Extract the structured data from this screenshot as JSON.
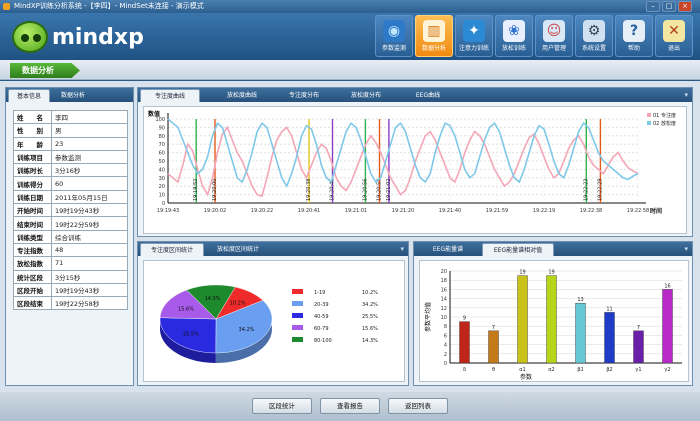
{
  "window": {
    "title": "MindXP训练分析系统 -【李四】- MindSet未连接 - 演示模式",
    "minimize": "–",
    "maximize": "□",
    "close": "×"
  },
  "logo": {
    "text": "mindxp"
  },
  "nav": [
    {
      "label": "参数监测",
      "icon": "◉"
    },
    {
      "label": "数据分析",
      "icon": "▥"
    },
    {
      "label": "注意力训练",
      "icon": "✦"
    },
    {
      "label": "放松训练",
      "icon": "❀"
    },
    {
      "label": "用户管理",
      "icon": "☺"
    },
    {
      "label": "系统设置",
      "icon": "⚙"
    },
    {
      "label": "帮助",
      "icon": "?"
    },
    {
      "label": "退出",
      "icon": "✕"
    }
  ],
  "section": {
    "title": "数据分析"
  },
  "left_tabs": [
    "基本信息",
    "数据分析"
  ],
  "info": [
    {
      "k": "姓　　名",
      "v": "李四"
    },
    {
      "k": "性　　别",
      "v": "男"
    },
    {
      "k": "年　　龄",
      "v": "23"
    },
    {
      "k": "训练项目",
      "v": "参数监测"
    },
    {
      "k": "训练时长",
      "v": "3分16秒"
    },
    {
      "k": "训练得分",
      "v": "60"
    },
    {
      "k": "训练日期",
      "v": "2011年05月15日"
    },
    {
      "k": "开始时间",
      "v": "19时19分43秒"
    },
    {
      "k": "结束时间",
      "v": "19时22分59秒"
    },
    {
      "k": "训练类型",
      "v": "综合训练"
    },
    {
      "k": "专注指数",
      "v": "48"
    },
    {
      "k": "放松指数",
      "v": "71"
    },
    {
      "k": "统计区段",
      "v": "3分15秒"
    },
    {
      "k": "区段开始",
      "v": "19时19分43秒"
    },
    {
      "k": "区段结束",
      "v": "19时22分58秒"
    }
  ],
  "chart_tabs": [
    "专注度曲线",
    "放松度曲线",
    "专注度分布",
    "放松度分布",
    "EEG曲线"
  ],
  "pie_tabs": [
    "专注度区间统计",
    "放松度区间统计"
  ],
  "bar_tabs": [
    "EEG能量谱",
    "EEG能量谱相对值"
  ],
  "footer": {
    "btn1": "区段统计",
    "btn2": "查看报告",
    "btn3": "返回列表"
  },
  "colors": {
    "attention": "#f4a6b6",
    "relaxation": "#7ec8e8",
    "accent": "#f39a14"
  },
  "chart_data": [
    {
      "type": "line",
      "ylabel": "数值",
      "xlabel": "时间",
      "ylim": [
        0,
        100
      ],
      "yticks": [
        0,
        10,
        20,
        30,
        40,
        50,
        60,
        70,
        80,
        90,
        100
      ],
      "xticks": [
        "19:19:43",
        "19:20:02",
        "19:20:22",
        "19:20:41",
        "19:21:01",
        "19:21:20",
        "19:21:40",
        "19:21:59",
        "19:22:19",
        "19:22:38",
        "19:22:58"
      ],
      "series": [
        {
          "name": "01 专注度",
          "values": [
            35,
            30,
            25,
            45,
            70,
            62,
            40,
            20,
            10,
            30,
            60,
            82,
            90,
            75,
            60,
            50,
            35,
            20,
            10,
            8,
            30,
            55,
            75,
            85,
            90,
            80,
            60,
            40,
            30,
            45,
            60,
            70,
            65,
            50,
            30,
            20,
            15,
            25,
            40,
            55,
            70,
            80,
            72,
            60,
            45,
            30,
            20,
            10,
            15,
            30,
            50,
            65,
            80,
            85,
            75,
            60,
            45,
            30,
            25,
            40,
            60,
            75,
            85,
            80,
            70,
            55,
            40,
            30,
            20,
            25,
            35,
            50,
            65,
            78,
            82,
            70,
            55,
            40,
            30,
            35,
            50,
            65,
            75,
            80,
            70,
            55,
            45,
            40,
            35,
            45,
            55,
            60,
            50,
            42,
            38,
            35
          ]
        },
        {
          "name": "02 放松度",
          "values": [
            100,
            95,
            90,
            75,
            60,
            45,
            35,
            40,
            55,
            80,
            95,
            90,
            70,
            50,
            30,
            25,
            40,
            60,
            85,
            95,
            90,
            70,
            50,
            30,
            20,
            35,
            55,
            80,
            92,
            88,
            70,
            45,
            30,
            25,
            45,
            65,
            85,
            95,
            90,
            75,
            55,
            35,
            25,
            30,
            50,
            70,
            90,
            95,
            85,
            65,
            45,
            30,
            25,
            35,
            60,
            80,
            95,
            92,
            80,
            60,
            40,
            30,
            35,
            55,
            75,
            90,
            95,
            85,
            65,
            45,
            30,
            25,
            40,
            60,
            80,
            92,
            88,
            70,
            50,
            35,
            30,
            45,
            65,
            85,
            95,
            90,
            75,
            60,
            50,
            45,
            40,
            35,
            30,
            28,
            32,
            35
          ]
        }
      ],
      "markers": [
        {
          "label": "19:19:52",
          "color": "#2db34a"
        },
        {
          "label": "19:20:00",
          "color": "#e2591c"
        },
        {
          "label": "19:20:38",
          "color": "#e6c21b"
        },
        {
          "label": "19:20:46",
          "color": "#8b3cc8"
        },
        {
          "label": "19:20:56",
          "color": "#2db34a"
        },
        {
          "label": "19:20:59",
          "color": "#e2591c"
        },
        {
          "label": "19:21:02",
          "color": "#8b3cc8"
        },
        {
          "label": "19:22:23",
          "color": "#2db34a"
        },
        {
          "label": "19:22:29",
          "color": "#e2591c"
        }
      ]
    },
    {
      "type": "pie",
      "categories": [
        "1-19",
        "20-39",
        "40-59",
        "60-79",
        "80-100"
      ],
      "values": [
        10.2,
        34.2,
        25.5,
        15.6,
        14.3
      ],
      "labels": [
        "10.2%",
        "34.2%",
        "25.5%",
        "15.6%",
        "14.3%"
      ],
      "colors": [
        "#ee2a2a",
        "#6a9ef0",
        "#2a2ae0",
        "#a85ae8",
        "#1e8a2e"
      ]
    },
    {
      "type": "bar",
      "categories": [
        "δ",
        "θ",
        "α1",
        "α2",
        "β1",
        "β2",
        "γ1",
        "γ2"
      ],
      "values": [
        9,
        7,
        19,
        19,
        13,
        11,
        7,
        16
      ],
      "ylabel": "参数平均值",
      "xlabel": "参数",
      "ylim": [
        0,
        20
      ],
      "yticks": [
        0,
        2,
        4,
        6,
        8,
        10,
        12,
        14,
        16,
        18,
        20
      ],
      "colors": [
        "#c0251a",
        "#c47a1a",
        "#c8c21a",
        "#b8d41a",
        "#66c8d4",
        "#1f3cc8",
        "#6a1fa8",
        "#b82ac8"
      ]
    }
  ]
}
